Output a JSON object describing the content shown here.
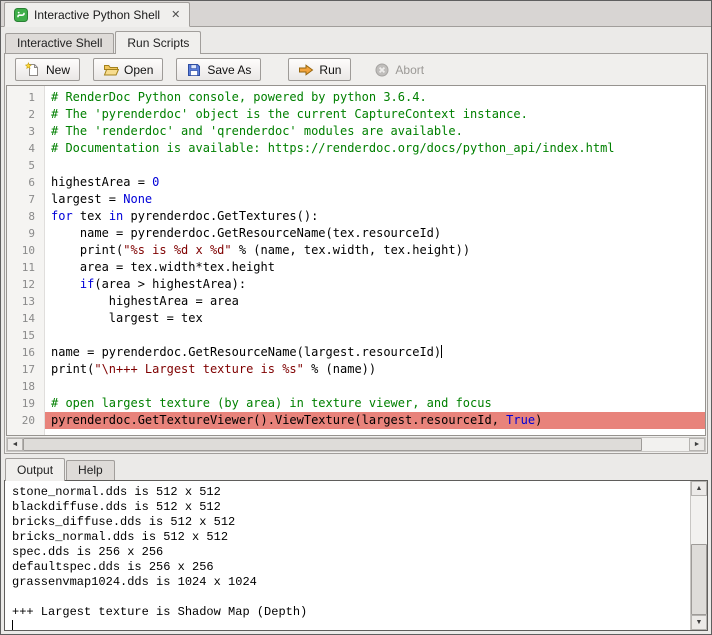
{
  "window": {
    "title": "Interactive Python Shell"
  },
  "top_tabs": [
    {
      "label": "Interactive Shell"
    },
    {
      "label": "Run Scripts"
    }
  ],
  "toolbar": {
    "new": "New",
    "open": "Open",
    "save_as": "Save As",
    "run": "Run",
    "abort": "Abort"
  },
  "editor": {
    "lines": [
      {
        "n": 1,
        "tokens": [
          [
            "c",
            "# RenderDoc Python console, powered by python 3.6.4."
          ]
        ]
      },
      {
        "n": 2,
        "tokens": [
          [
            "c",
            "# The 'pyrenderdoc' object is the current CaptureContext instance."
          ]
        ]
      },
      {
        "n": 3,
        "tokens": [
          [
            "c",
            "# The 'renderdoc' and 'qrenderdoc' modules are available."
          ]
        ]
      },
      {
        "n": 4,
        "tokens": [
          [
            "c",
            "# Documentation is available: https://renderdoc.org/docs/python_api/index.html"
          ]
        ]
      },
      {
        "n": 5,
        "tokens": []
      },
      {
        "n": 6,
        "tokens": [
          [
            "p",
            "highestArea = "
          ],
          [
            "n",
            "0"
          ]
        ]
      },
      {
        "n": 7,
        "tokens": [
          [
            "p",
            "largest = "
          ],
          [
            "k",
            "None"
          ]
        ]
      },
      {
        "n": 8,
        "tokens": [
          [
            "k",
            "for"
          ],
          [
            "p",
            " tex "
          ],
          [
            "k",
            "in"
          ],
          [
            "p",
            " pyrenderdoc.GetTextures():"
          ]
        ]
      },
      {
        "n": 9,
        "tokens": [
          [
            "p",
            "    name = pyrenderdoc.GetResourceName(tex.resourceId)"
          ]
        ]
      },
      {
        "n": 10,
        "tokens": [
          [
            "p",
            "    print("
          ],
          [
            "s",
            "\"%s is %d x %d\""
          ],
          [
            "p",
            " % (name, tex.width, tex.height))"
          ]
        ]
      },
      {
        "n": 11,
        "tokens": [
          [
            "p",
            "    area = tex.width*tex.height"
          ]
        ]
      },
      {
        "n": 12,
        "tokens": [
          [
            "p",
            "    "
          ],
          [
            "k",
            "if"
          ],
          [
            "p",
            "(area > highestArea):"
          ]
        ]
      },
      {
        "n": 13,
        "tokens": [
          [
            "p",
            "        highestArea = area"
          ]
        ]
      },
      {
        "n": 14,
        "tokens": [
          [
            "p",
            "        largest = tex"
          ]
        ]
      },
      {
        "n": 15,
        "tokens": []
      },
      {
        "n": 16,
        "caret": true,
        "tokens": [
          [
            "p",
            "name = pyrenderdoc.GetResourceName(largest.resourceId)"
          ]
        ]
      },
      {
        "n": 17,
        "tokens": [
          [
            "p",
            "print("
          ],
          [
            "s",
            "\"\\n+++ Largest texture is %s\""
          ],
          [
            "p",
            " % (name))"
          ]
        ]
      },
      {
        "n": 18,
        "tokens": []
      },
      {
        "n": 19,
        "tokens": [
          [
            "c",
            "# open largest texture (by area) in texture viewer, and focus"
          ]
        ]
      },
      {
        "n": 20,
        "error": true,
        "tokens": [
          [
            "p",
            "pyrenderdoc.GetTextureViewer().ViewTexture(largest.resourceId, "
          ],
          [
            "k",
            "True"
          ],
          [
            "p",
            ")"
          ]
        ]
      }
    ]
  },
  "bottom_tabs": [
    {
      "label": "Output"
    },
    {
      "label": "Help"
    }
  ],
  "output": {
    "lines": [
      "stone_normal.dds is 512 x 512",
      "blackdiffuse.dds is 512 x 512",
      "bricks_diffuse.dds is 512 x 512",
      "bricks_normal.dds is 512 x 512",
      "spec.dds is 256 x 256",
      "defaultspec.dds is 256 x 256",
      "grassenvmap1024.dds is 1024 x 1024",
      "",
      "+++ Largest texture is Shadow Map (Depth)"
    ]
  },
  "icons": {
    "close": "✕",
    "scroll_left": "◄",
    "scroll_right": "►",
    "scroll_up": "▲",
    "scroll_down": "▼"
  },
  "colors": {
    "comment": "#008000",
    "keyword": "#0000d8",
    "number": "#0000d8",
    "string": "#7f0000",
    "plain": "#000000",
    "gutter_num": "#8a8a8a",
    "error_line_bg": "#e8837b",
    "run_arrow": "#f2a33c",
    "python_green": "#3fae49"
  }
}
